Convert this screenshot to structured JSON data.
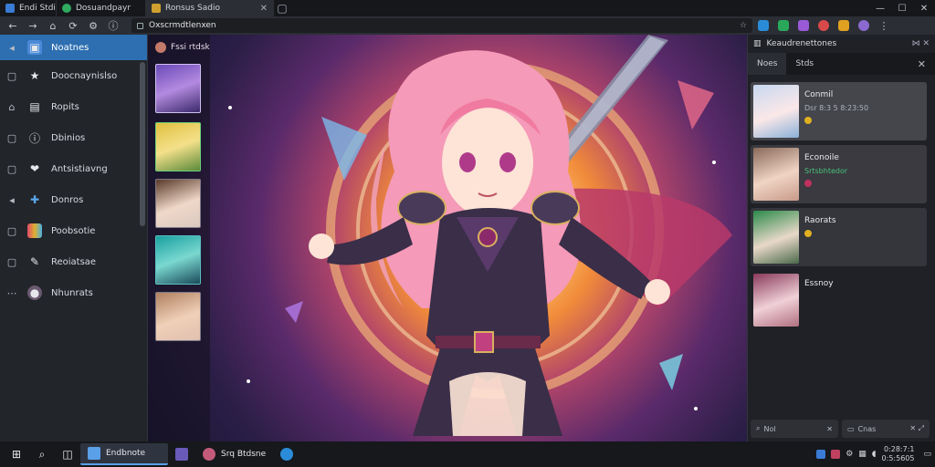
{
  "tabs": [
    {
      "title": "Endi Stdid",
      "color": "#3a7bd5"
    },
    {
      "title": "Dosuandpayr",
      "color": "#2faa5e"
    },
    {
      "title": "Ronsus Sadio",
      "color": "#d0a030"
    }
  ],
  "address": {
    "url": "Oxscrmdtlenxen"
  },
  "sidebar": {
    "items": [
      {
        "label": "Noatnes",
        "icon": "folder-icon",
        "color": "#4a8ad8"
      },
      {
        "label": "Doocnaynislso",
        "icon": "star-icon",
        "color": "#3a3d44"
      },
      {
        "label": "Ropits",
        "icon": "document-icon",
        "color": "#3a3d44"
      },
      {
        "label": "Dbinios",
        "icon": "info-icon",
        "color": "#3a3d44"
      },
      {
        "label": "Antsistiavng",
        "icon": "heart-icon",
        "color": "#3a3d44"
      },
      {
        "label": "Donros",
        "icon": "puzzle-icon",
        "color": "#2a6fb0"
      },
      {
        "label": "Poobsotie",
        "icon": "palette-icon",
        "color": "#3a3d44"
      },
      {
        "label": "Reoiatsae",
        "icon": "pin-icon",
        "color": "#3a3d44"
      },
      {
        "label": "Nhunrats",
        "icon": "user-icon",
        "color": "#3a3d44"
      }
    ]
  },
  "gallery": {
    "title": "Fssi rtdsk"
  },
  "right_panel": {
    "title": "Keaudrenettones",
    "tabs": [
      "Noes",
      "Stds"
    ],
    "cards": [
      {
        "name": "Conmil",
        "sub": "Dsr 8:3 5 8:23:50",
        "accent": "#e0b020"
      },
      {
        "name": "Econoile",
        "sub": "Srtsbhtedor",
        "accent": "#c03060"
      },
      {
        "name": "Raorats",
        "sub": "",
        "accent": "#e0b020"
      },
      {
        "name": "Essnoy",
        "sub": "",
        "accent": ""
      }
    ],
    "footer": [
      "Nol",
      "Cnas"
    ]
  },
  "taskbar": {
    "apps": [
      {
        "label": "Endbnote",
        "color": "#5aa0e8"
      },
      {
        "label": "Srq Btdsne",
        "color": "#c45a7a"
      }
    ],
    "time": "0:28:7:1",
    "date": "0:5:5605"
  }
}
